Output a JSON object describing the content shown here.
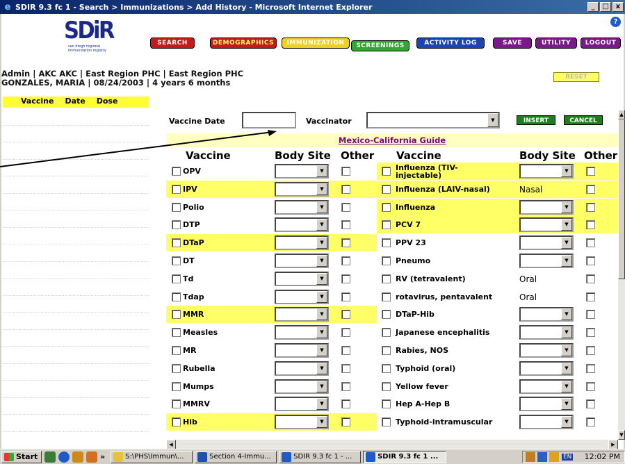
{
  "window": {
    "title": "SDIR 9.3 fc 1 - Search > Immunizations > Add History - Microsoft Internet Explorer",
    "min": "_",
    "max": "□",
    "close": "x"
  },
  "logo": {
    "text": "SDiR",
    "tagline": "san diego regional immunization registry"
  },
  "nav": {
    "search": "SEARCH",
    "demographics": "DEMOGRAPHICS",
    "immunization": "IMMUNIZATION",
    "screenings": "SCREENINGS",
    "activity_log": "ACTIVITY LOG",
    "save": "SAVE",
    "utility": "UTILITY",
    "logout": "LOGOUT",
    "help": "?"
  },
  "patient": {
    "line1": "Admin | AKC AKC | East Region PHC | East Region PHC",
    "line2": "GONZALES, MARIA | 08/24/2003 | 4 years 6 months"
  },
  "reset_label": "RESET",
  "history": {
    "vaccine": "Vaccine",
    "date": "Date",
    "dose": "Dose"
  },
  "form": {
    "vaccine_date_label": "Vaccine Date",
    "vaccine_date_value": "",
    "vaccinator_label": "Vaccinator",
    "vaccinator_value": "",
    "insert": "INSERT",
    "cancel": "CANCEL"
  },
  "guide_link": "Mexico-California Guide",
  "headers": {
    "vaccine": "Vaccine",
    "body_site": "Body Site",
    "other": "Other"
  },
  "left_rows": [
    {
      "name": "OPV",
      "yellow": false
    },
    {
      "name": "IPV",
      "yellow": true
    },
    {
      "name": "Polio",
      "yellow": false
    },
    {
      "name": "DTP",
      "yellow": false
    },
    {
      "name": "DTaP",
      "yellow": true
    },
    {
      "name": "DT",
      "yellow": false
    },
    {
      "name": "Td",
      "yellow": false
    },
    {
      "name": "Tdap",
      "yellow": false
    },
    {
      "name": "MMR",
      "yellow": true
    },
    {
      "name": "Measles",
      "yellow": false
    },
    {
      "name": "MR",
      "yellow": false
    },
    {
      "name": "Rubella",
      "yellow": false
    },
    {
      "name": "Mumps",
      "yellow": false
    },
    {
      "name": "MMRV",
      "yellow": false
    },
    {
      "name": "Hib",
      "yellow": true
    }
  ],
  "right_rows": [
    {
      "name": "Influenza (TIV-injectable)",
      "site": "",
      "yellow": true
    },
    {
      "name": "Influenza (LAIV-nasal)",
      "site": "Nasal",
      "yellow": true
    },
    {
      "name": "Influenza",
      "site": "",
      "yellow": true
    },
    {
      "name": "PCV 7",
      "site": "",
      "yellow": true
    },
    {
      "name": "PPV 23",
      "site": "",
      "yellow": false
    },
    {
      "name": "Pneumo",
      "site": "",
      "yellow": false
    },
    {
      "name": "RV (tetravalent)",
      "site": "Oral",
      "yellow": false
    },
    {
      "name": "rotavirus, pentavalent",
      "site": "Oral",
      "yellow": false
    },
    {
      "name": "DTaP-Hib",
      "site": "",
      "yellow": false
    },
    {
      "name": "Japanese encephalitis",
      "site": "",
      "yellow": false
    },
    {
      "name": "Rabies, NOS",
      "site": "",
      "yellow": false
    },
    {
      "name": "Typhoid (oral)",
      "site": "",
      "yellow": false
    },
    {
      "name": "Yellow fever",
      "site": "",
      "yellow": false
    },
    {
      "name": "Hep A-Hep B",
      "site": "",
      "yellow": false
    },
    {
      "name": "Typhoid-intramuscular",
      "site": "",
      "yellow": false
    }
  ],
  "taskbar": {
    "start": "Start",
    "chevron": "»",
    "items": [
      "S:\\PHS\\Immun\\...",
      "Section 4-Immu...",
      "SDIR 9.3 fc 1 - ...",
      "SDIR 9.3 fc 1 ..."
    ],
    "lang": "EN",
    "clock": "12:02 PM"
  }
}
